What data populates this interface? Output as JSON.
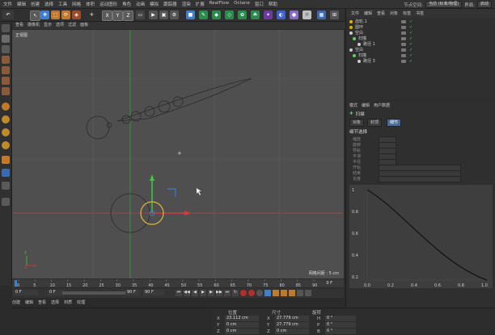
{
  "menubar": {
    "items": [
      "文件",
      "编辑",
      "创建",
      "选择",
      "工具",
      "网格",
      "体积",
      "运动图形",
      "角色",
      "动画",
      "模拟",
      "跟踪器",
      "渲染",
      "扩展",
      "RealFlow",
      "Octane",
      "窗口",
      "帮助"
    ],
    "layout_label": "节点空间:",
    "layout_value": "当前 (标准/物理)",
    "interface_label": "界面:",
    "interface_value": "启动"
  },
  "viewport": {
    "menu": [
      "查看",
      "摄像机",
      "显示",
      "选项",
      "过滤",
      "面板"
    ],
    "label": "正视图",
    "grid_info": "网格间距 : 5 cm"
  },
  "timeline": {
    "ticks": [
      "0",
      "5",
      "10",
      "15",
      "20",
      "25",
      "30",
      "35",
      "40",
      "45",
      "50",
      "55",
      "60",
      "65",
      "70",
      "75",
      "80",
      "85",
      "90"
    ],
    "current_frame": "0 F",
    "start": "0 F",
    "min": "0 F",
    "max": "90 F",
    "end": "90 F"
  },
  "materials": {
    "tabs": [
      "创建",
      "编辑",
      "查看",
      "选择",
      "材质",
      "纹理"
    ]
  },
  "coordinates": {
    "headers": [
      "位置",
      "尺寸",
      "旋转"
    ],
    "rows": [
      {
        "axis": "X",
        "pos": "23.112 cm",
        "size_axis": "X",
        "size": "27.779 cm",
        "rot_axis": "H",
        "rot": "0 °"
      },
      {
        "axis": "Y",
        "pos": "0 cm",
        "size_axis": "Y",
        "size": "27.779 cm",
        "rot_axis": "P",
        "rot": "0 °"
      },
      {
        "axis": "Z",
        "pos": "0 cm",
        "size_axis": "Z",
        "size": "0 cm",
        "rot_axis": "B",
        "rot": "0 °"
      }
    ]
  },
  "objects_panel": {
    "tabs": [
      "文件",
      "编辑",
      "查看",
      "对象",
      "标签",
      "书签"
    ],
    "rows": [
      {
        "name": "齿轮.1",
        "color": "#e0b000"
      },
      {
        "name": "圆环",
        "color": "#e0b000"
      },
      {
        "name": "空白",
        "color": "#cccccc"
      },
      {
        "name": "扫描",
        "color": "#66cc66"
      },
      {
        "name": "路径 1",
        "color": "#cccccc"
      },
      {
        "name": "空白",
        "color": "#cccccc"
      },
      {
        "name": "扫描",
        "color": "#66cc66"
      },
      {
        "name": "路径 3",
        "color": "#cccccc"
      }
    ]
  },
  "attributes": {
    "tabs": [
      "模式",
      "编辑",
      "用户数据"
    ],
    "title": "扫描",
    "subtabs": [
      "对象",
      "封顶",
      "细节"
    ],
    "section": "细节选择",
    "fields": [
      "缩放",
      "旋转",
      "导轨",
      "平滑",
      "半径",
      "开始",
      "结束",
      "长度"
    ],
    "graph_y": [
      "1",
      "0.8",
      "0.6",
      "0.4",
      "0.2"
    ],
    "graph_x": [
      "0.0",
      "0.2",
      "0.4",
      "0.6",
      "0.8",
      "1.0"
    ]
  },
  "colors": {
    "accent": "#3d7fd1",
    "x_axis": "#d23c3c",
    "y_axis": "#3cc83c",
    "z_axis": "#3c6ed2",
    "gizmo_ring": "#e6b43c"
  }
}
